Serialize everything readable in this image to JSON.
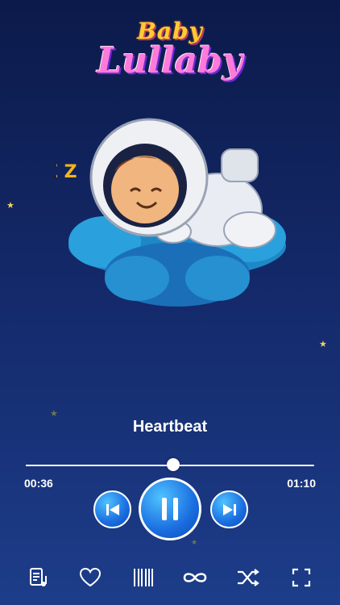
{
  "logo": {
    "line1": "Baby",
    "line2": "Lullaby"
  },
  "illustration": {
    "sleep_text": "Z Z"
  },
  "track": {
    "title": "Heartbeat",
    "current_time": "00:36",
    "total_time": "01:10",
    "progress_fraction": 0.51
  },
  "controls": {
    "previous": "previous-icon",
    "play_pause": "pause-icon",
    "next": "next-icon"
  },
  "bottom_bar": [
    {
      "name": "playlist-icon"
    },
    {
      "name": "heart-icon"
    },
    {
      "name": "barcode-icon"
    },
    {
      "name": "infinity-icon"
    },
    {
      "name": "shuffle-icon"
    },
    {
      "name": "fullscreen-icon"
    }
  ],
  "colors": {
    "background_top": "#0c1a4a",
    "background_bottom": "#1d3d8a",
    "button": "#1a6de0",
    "accent_pink": "#ff7ad9",
    "accent_yellow": "#ffcc33"
  }
}
